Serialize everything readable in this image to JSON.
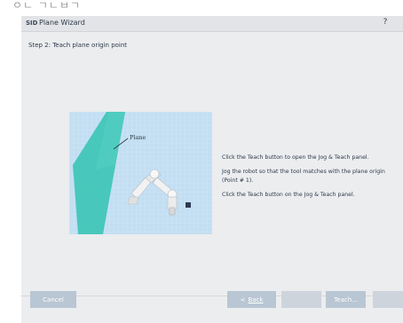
{
  "top_strip_text": "ㅇㄴ ㄱㄴㅂㄱ",
  "window": {
    "title": "Plane Wizard",
    "app_icon": "SID",
    "help_label": "?"
  },
  "step_title": "Step 2: Teach plane origin point",
  "illustration": {
    "plane_label": "Plane",
    "colors": {
      "grid_bg": "#c3def2",
      "plane": "#3ec4b6",
      "robot": "#f2f2f2"
    }
  },
  "instructions": [
    "Click the Teach button to open the Jog & Teach panel.",
    "Jog the robot so that the tool matches with the plane origin (Point # 1).",
    "Click the Teach button on the Jog & Teach panel."
  ],
  "buttons": {
    "cancel": "Cancel",
    "back_arrow": "<",
    "back": "Back",
    "teach": "Teach..."
  },
  "colors": {
    "button": "#b9c6d3",
    "button_disabled": "#cdd4dc",
    "window_bg": "#ecedef"
  }
}
